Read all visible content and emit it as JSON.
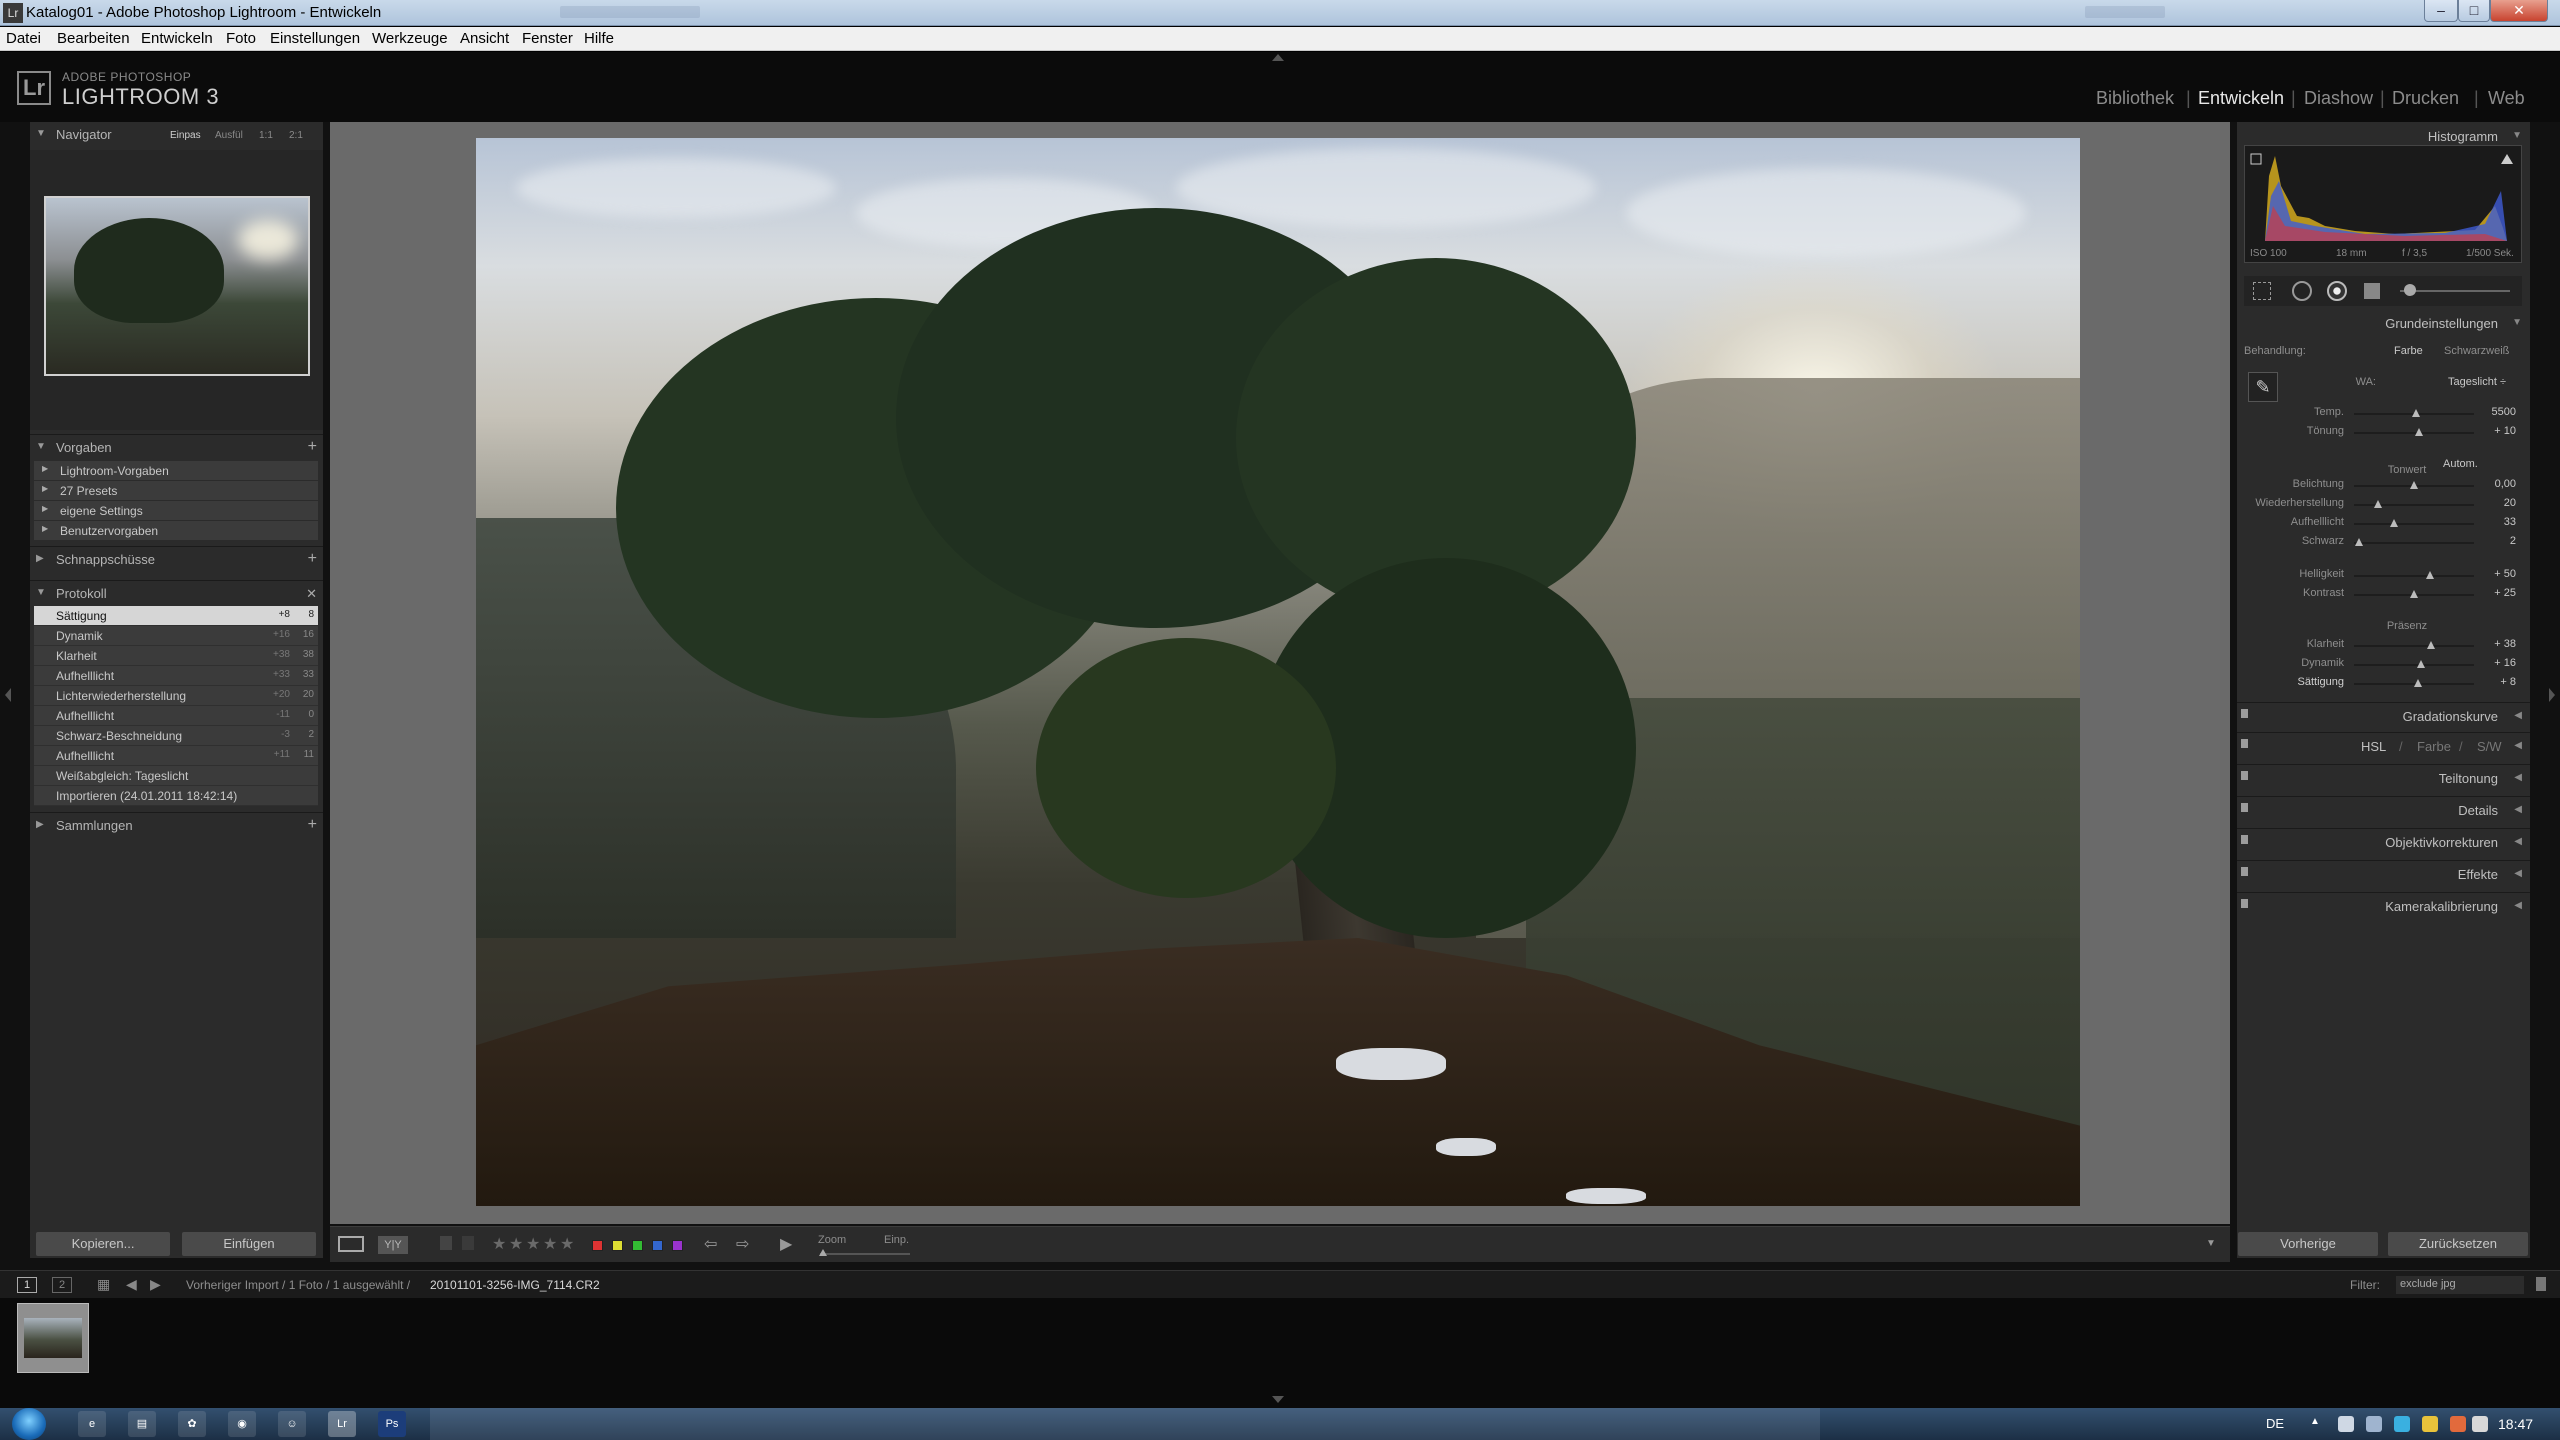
{
  "window": {
    "title": "Katalog01 - Adobe Photoshop Lightroom - Entwickeln",
    "app_icon": "Lr",
    "min": "–",
    "max": "□",
    "close": "✕"
  },
  "menu": [
    "Datei",
    "Bearbeiten",
    "Entwickeln",
    "Foto",
    "Einstellungen",
    "Werkzeuge",
    "Ansicht",
    "Fenster",
    "Hilfe"
  ],
  "brand": {
    "logo": "Lr",
    "small": "ADOBE PHOTOSHOP",
    "big": "LIGHTROOM 3"
  },
  "modules": [
    {
      "label": "Bibliothek",
      "active": false
    },
    {
      "label": "Entwickeln",
      "active": true
    },
    {
      "label": "Diashow",
      "active": false
    },
    {
      "label": "Drucken",
      "active": false
    },
    {
      "label": "Web",
      "active": false
    }
  ],
  "left": {
    "navigator": {
      "title": "Navigator",
      "zooms": [
        "Einpas",
        "Ausfül",
        "1:1",
        "2:1"
      ]
    },
    "presets": {
      "title": "Vorgaben",
      "items": [
        "Lightroom-Vorgaben",
        "27 Presets",
        "eigene Settings",
        "Benutzervorgaben"
      ]
    },
    "snapshots": {
      "title": "Schnappschüsse"
    },
    "history": {
      "title": "Protokoll",
      "items": [
        {
          "label": "Sättigung",
          "delta": "+8",
          "value": "8"
        },
        {
          "label": "Dynamik",
          "delta": "+16",
          "value": "16"
        },
        {
          "label": "Klarheit",
          "delta": "+38",
          "value": "38"
        },
        {
          "label": "Aufhelllicht",
          "delta": "+33",
          "value": "33"
        },
        {
          "label": "Lichterwiederherstellung",
          "delta": "+20",
          "value": "20"
        },
        {
          "label": "Aufhelllicht",
          "delta": "-11",
          "value": "0"
        },
        {
          "label": "Schwarz-Beschneidung",
          "delta": "-3",
          "value": "2"
        },
        {
          "label": "Aufhelllicht",
          "delta": "+11",
          "value": "11"
        },
        {
          "label": "Weißabgleich: Tageslicht",
          "delta": "",
          "value": ""
        },
        {
          "label": "Importieren (24.01.2011 18:42:14)",
          "delta": "",
          "value": ""
        }
      ]
    },
    "collections": {
      "title": "Sammlungen"
    },
    "copy_btn": "Kopieren...",
    "paste_btn": "Einfügen"
  },
  "toolbar": {
    "zoom_label": "Zoom",
    "fit_label": "Einp.",
    "view_compare": "Y|Y"
  },
  "right": {
    "histogram": {
      "title": "Histogramm",
      "iso": "ISO 100",
      "focal": "18 mm",
      "aperture": "f / 3,5",
      "shutter": "1/500 Sek."
    },
    "basic": {
      "title": "Grundeinstellungen",
      "treatment_label": "Behandlung:",
      "treatment_color": "Farbe",
      "treatment_bw": "Schwarzweiß",
      "wb_label": "WA:",
      "wb_value": "Tageslicht ÷",
      "sliders1": [
        {
          "label": "Temp.",
          "value": "5500",
          "pos": 0.52
        },
        {
          "label": "Tönung",
          "value": "+ 10",
          "pos": 0.54
        }
      ],
      "tone_label": "Tonwert",
      "auto_label": "Autom.",
      "sliders2": [
        {
          "label": "Belichtung",
          "value": "0,00",
          "pos": 0.5
        },
        {
          "label": "Wiederherstellung",
          "value": "20",
          "pos": 0.2
        },
        {
          "label": "Aufhelllicht",
          "value": "33",
          "pos": 0.33
        },
        {
          "label": "Schwarz",
          "value": "2",
          "pos": 0.04
        }
      ],
      "sliders3": [
        {
          "label": "Helligkeit",
          "value": "+ 50",
          "pos": 0.63
        },
        {
          "label": "Kontrast",
          "value": "+ 25",
          "pos": 0.5
        }
      ],
      "presence_label": "Präsenz",
      "sliders4": [
        {
          "label": "Klarheit",
          "value": "+ 38",
          "pos": 0.64
        },
        {
          "label": "Dynamik",
          "value": "+ 16",
          "pos": 0.56
        },
        {
          "label": "Sättigung",
          "value": "+ 8",
          "pos": 0.53
        }
      ]
    },
    "panels": [
      "Gradationskurve",
      "Teiltonung",
      "Details",
      "Objektivkorrekturen",
      "Effekte",
      "Kamerakalibrierung"
    ],
    "hsl": {
      "hsl": "HSL",
      "sep": "/",
      "farbe": "Farbe",
      "sw": "S/W"
    },
    "prev_btn": "Vorherige",
    "reset_btn": "Zurücksetzen"
  },
  "filmstrip": {
    "page1": "1",
    "page2": "2",
    "path_prefix": "Vorheriger Import / 1 Foto / 1 ausgewählt /",
    "filename": "20101101-3256-IMG_7114.CR2",
    "filter_label": "Filter:",
    "filter_value": "exclude jpg"
  },
  "taskbar": {
    "lang": "DE",
    "time": "18:47"
  }
}
